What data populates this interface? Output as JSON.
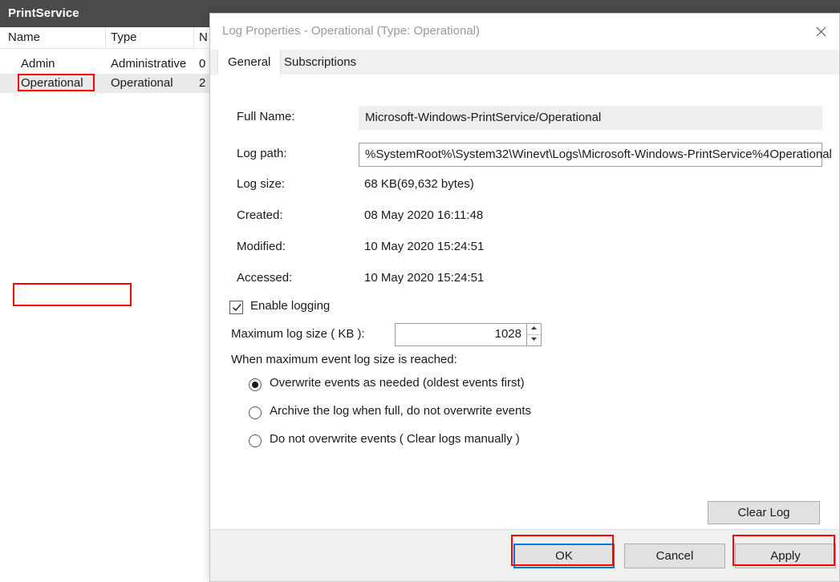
{
  "background_window": {
    "title": "PrintService",
    "list": {
      "columns": [
        "Name",
        "Type",
        "N"
      ],
      "rows": [
        {
          "name": "Admin",
          "type": "Administrative",
          "number": "0",
          "selected": false
        },
        {
          "name": "Operational",
          "type": "Operational",
          "number": "2",
          "selected": true
        }
      ]
    }
  },
  "dialog": {
    "title": "Log Properties - Operational (Type: Operational)",
    "close_icon": "close-icon",
    "tabs": [
      {
        "label": "General",
        "active": true
      },
      {
        "label": "Subscriptions",
        "active": false
      }
    ],
    "fields": {
      "full_name_label": "Full Name:",
      "full_name_value": "Microsoft-Windows-PrintService/Operational",
      "log_path_label": "Log path:",
      "log_path_value": "%SystemRoot%\\System32\\Winevt\\Logs\\Microsoft-Windows-PrintService%4Operational",
      "log_size_label": "Log size:",
      "log_size_value": "68 KB(69,632 bytes)",
      "created_label": "Created:",
      "created_value": "08 May 2020 16:11:48",
      "modified_label": "Modified:",
      "modified_value": "10 May 2020 15:24:51",
      "accessed_label": "Accessed:",
      "accessed_value": "10 May 2020 15:24:51"
    },
    "enable_logging": {
      "label": "Enable logging",
      "checked": true
    },
    "max_log_size": {
      "label": "Maximum log size ( KB ):",
      "value": "1028"
    },
    "overflow_policy": {
      "label": "When maximum event log size is reached:",
      "options": [
        {
          "label": "Overwrite events as needed (oldest events first)",
          "selected": true
        },
        {
          "label": "Archive the log when full, do not overwrite events",
          "selected": false
        },
        {
          "label": "Do not overwrite events ( Clear logs manually )",
          "selected": false
        }
      ]
    },
    "clear_log_label": "Clear Log",
    "buttons": {
      "ok": "OK",
      "cancel": "Cancel",
      "apply": "Apply"
    }
  },
  "colors": {
    "titlebar": "#4a4a4a",
    "annotation": "#ff0000",
    "focus": "#0078d7"
  }
}
